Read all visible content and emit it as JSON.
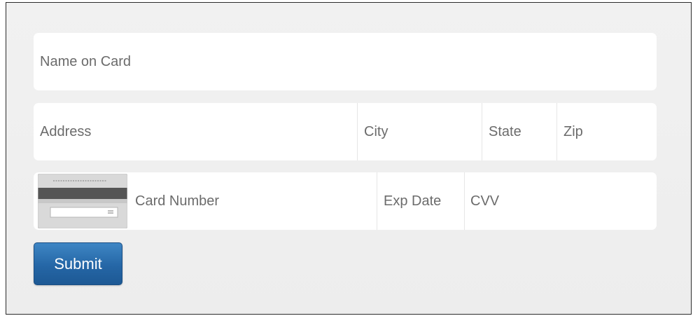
{
  "form": {
    "name_placeholder": "Name on Card",
    "address_placeholder": "Address",
    "city_placeholder": "City",
    "state_placeholder": "State",
    "zip_placeholder": "Zip",
    "card_number_placeholder": "Card Number",
    "exp_date_placeholder": "Exp Date",
    "cvv_placeholder": "CVV",
    "card_icon": "credit-card-back-icon",
    "submit_label": "Submit"
  },
  "colors": {
    "submit_button": "#2566a6",
    "placeholder_text": "#6b6b6b",
    "background": "#efefef"
  }
}
